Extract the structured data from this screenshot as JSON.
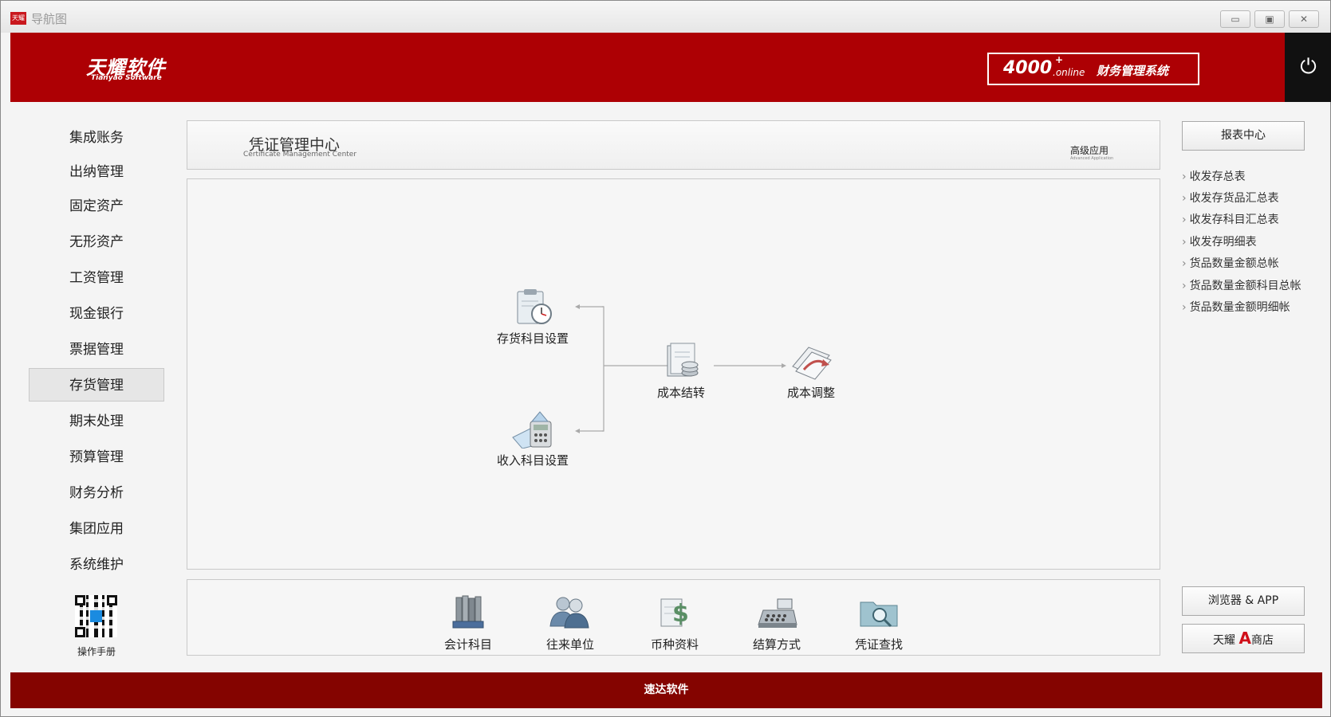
{
  "window": {
    "app_icon_text": "天耀",
    "title": "导航图",
    "controls": {
      "minimize": "▭",
      "maximize": "▣",
      "close": "✕"
    }
  },
  "header": {
    "logo_main": "天耀软件",
    "logo_sub": "Tianyao Software",
    "product_num": "4000",
    "product_sup": "+",
    "product_online": ".online",
    "product_name": "财务管理系统",
    "power_icon": "⏻"
  },
  "sidebar": {
    "items": [
      {
        "label": "集成账务"
      },
      {
        "label": "出纳管理"
      },
      {
        "label": "固定资产"
      },
      {
        "label": "无形资产"
      },
      {
        "label": "工资管理"
      },
      {
        "label": "现金银行"
      },
      {
        "label": "票据管理"
      },
      {
        "label": "存货管理",
        "active": true
      },
      {
        "label": "期末处理"
      },
      {
        "label": "预算管理"
      },
      {
        "label": "财务分析"
      },
      {
        "label": "集团应用"
      },
      {
        "label": "系统维护"
      }
    ],
    "qr_label": "操作手册"
  },
  "section": {
    "title": "凭证管理中心",
    "subtitle": "Certificate Management Center",
    "advanced": "高级应用",
    "advanced_sub": "Advanced Application"
  },
  "flow": {
    "nodes": [
      {
        "label": "存货科目设置",
        "icon": "clipboard-clock-icon"
      },
      {
        "label": "收入科目设置",
        "icon": "calculator-icon"
      },
      {
        "label": "成本结转",
        "icon": "folder-coins-icon"
      },
      {
        "label": "成本调整",
        "icon": "documents-arrow-icon"
      }
    ]
  },
  "tools": [
    {
      "label": "会计科目",
      "icon": "binders-icon"
    },
    {
      "label": "往来单位",
      "icon": "users-icon"
    },
    {
      "label": "币种资料",
      "icon": "dollar-doc-icon"
    },
    {
      "label": "结算方式",
      "icon": "cash-register-icon"
    },
    {
      "label": "凭证查找",
      "icon": "folder-search-icon"
    }
  ],
  "reports": {
    "center_label": "报表中心",
    "links": [
      "收发存总表",
      "收发存货品汇总表",
      "收发存科目汇总表",
      "收发存明细表",
      "货品数量金额总帐",
      "货品数量金额科目总帐",
      "货品数量金额明细帐"
    ],
    "browser_app_label": "浏览器 & APP",
    "store_prefix": "天耀",
    "store_letter": "A",
    "store_suffix": "商店"
  },
  "footer": {
    "text": "速达软件"
  },
  "colors": {
    "brand_red": "#ad0004",
    "footer_red": "#840400",
    "power_bg": "#111111"
  }
}
